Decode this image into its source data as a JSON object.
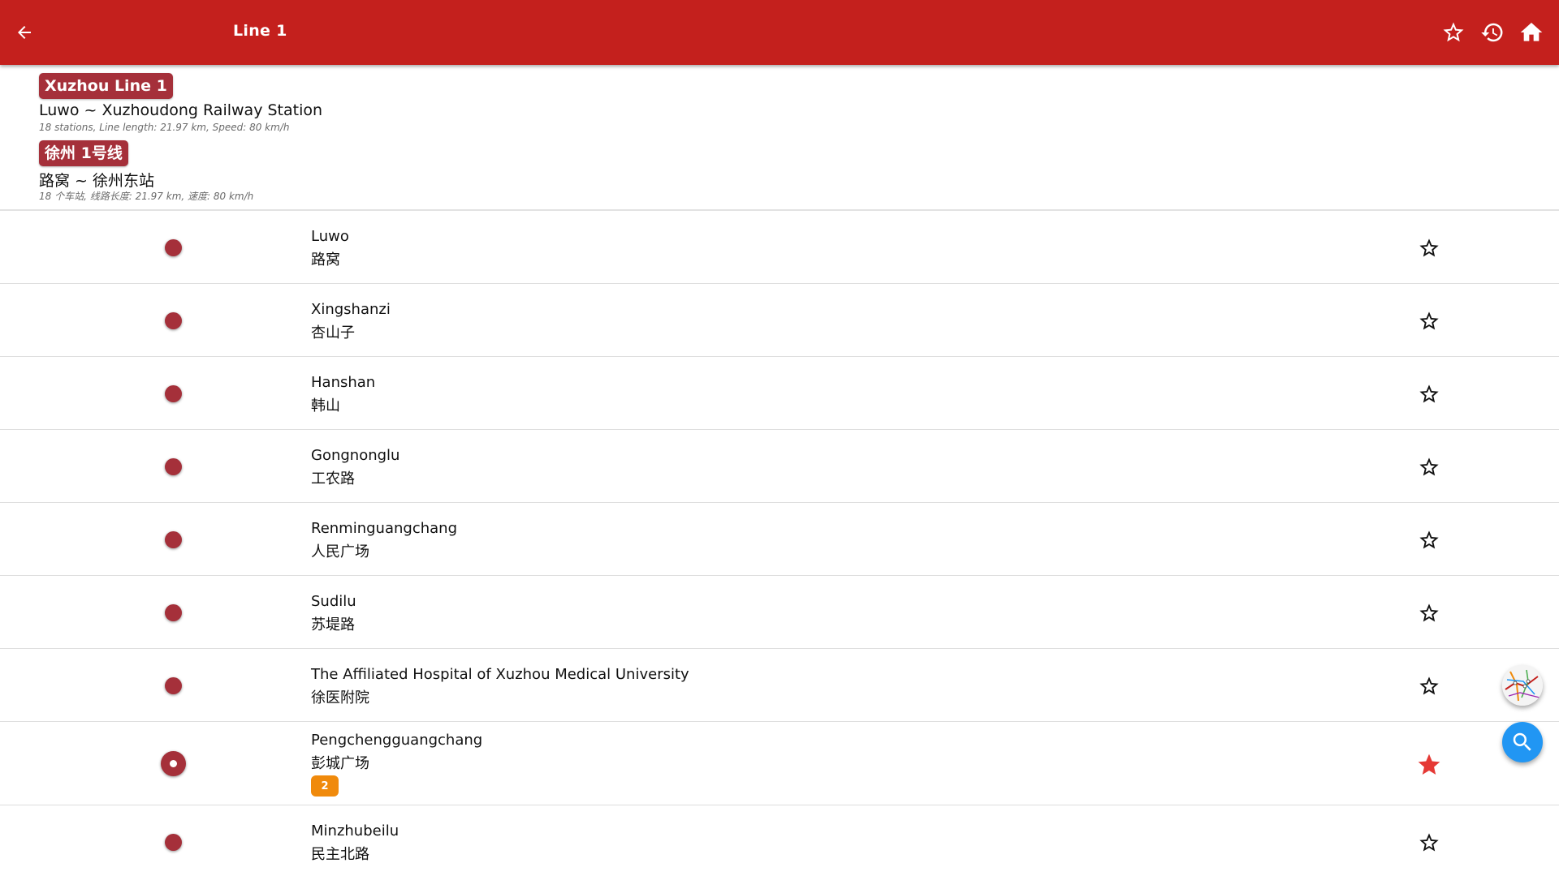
{
  "appbar": {
    "title": "Line 1",
    "icons": [
      "arrow-left-icon",
      "star-outline-icon",
      "history-icon",
      "home-icon"
    ]
  },
  "line": {
    "en": {
      "badge": "Xuzhou Line 1",
      "route": "Luwo ~ Xuzhoudong Railway Station",
      "meta": "18 stations, Line length: 21.97 km, Speed: 80 km/h"
    },
    "zh": {
      "badge": "徐州 1号线",
      "route": "路窝 ~ 徐州东站",
      "meta": "18 个车站, 线路长度: 21.97 km, 速度: 80 km/h"
    },
    "color": "#a5303a"
  },
  "stations": [
    {
      "en": "Luwo",
      "zh": "路窝",
      "favorite": false
    },
    {
      "en": "Xingshanzi",
      "zh": "杏山子",
      "favorite": false
    },
    {
      "en": "Hanshan",
      "zh": "韩山",
      "favorite": false
    },
    {
      "en": "Gongnonglu",
      "zh": "工农路",
      "favorite": false
    },
    {
      "en": "Renminguangchang",
      "zh": "人民广场",
      "favorite": false
    },
    {
      "en": "Sudilu",
      "zh": "苏堤路",
      "favorite": false
    },
    {
      "en": "The Affiliated Hospital of Xuzhou Medical University",
      "zh": "徐医附院",
      "favorite": false
    },
    {
      "en": "Pengchengguangchang",
      "zh": "彭城广场",
      "favorite": true,
      "current": true,
      "transfer": "2"
    },
    {
      "en": "Minzhubeilu",
      "zh": "民主北路",
      "favorite": false
    }
  ],
  "colors": {
    "appbar": "#c4201d",
    "transfer_badge": "#f08a0c",
    "favorite_star": "#e53935",
    "search_fab": "#2196f3"
  },
  "fabs": [
    "map-icon",
    "search-icon"
  ]
}
